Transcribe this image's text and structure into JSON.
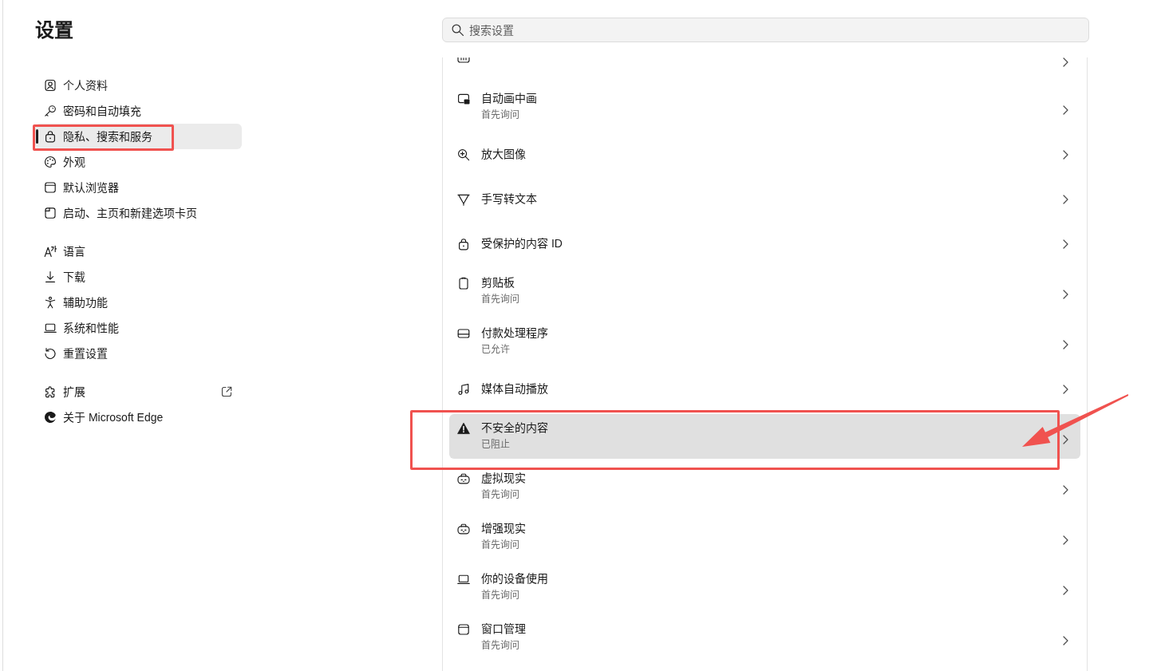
{
  "sidebar": {
    "title": "设置",
    "groups": [
      {
        "items": [
          {
            "label": "个人资料",
            "selected": false,
            "external_link": false,
            "annotated": false
          },
          {
            "label": "密码和自动填充",
            "selected": false,
            "external_link": false,
            "annotated": false
          },
          {
            "label": "隐私、搜索和服务",
            "selected": true,
            "external_link": false,
            "annotated": true
          },
          {
            "label": "外观",
            "selected": false,
            "external_link": false,
            "annotated": false
          },
          {
            "label": "默认浏览器",
            "selected": false,
            "external_link": false,
            "annotated": false
          },
          {
            "label": "启动、主页和新建选项卡页",
            "selected": false,
            "external_link": false,
            "annotated": false
          }
        ]
      },
      {
        "items": [
          {
            "label": "语言",
            "selected": false,
            "external_link": false,
            "annotated": false
          },
          {
            "label": "下载",
            "selected": false,
            "external_link": false,
            "annotated": false
          },
          {
            "label": "辅助功能",
            "selected": false,
            "external_link": false,
            "annotated": false
          },
          {
            "label": "系统和性能",
            "selected": false,
            "external_link": false,
            "annotated": false
          },
          {
            "label": "重置设置",
            "selected": false,
            "external_link": false,
            "annotated": false
          }
        ]
      },
      {
        "items": [
          {
            "label": "扩展",
            "selected": false,
            "external_link": true,
            "annotated": false
          },
          {
            "label": "关于 Microsoft Edge",
            "selected": false,
            "external_link": false,
            "annotated": false
          }
        ]
      }
    ]
  },
  "search": {
    "placeholder": "搜索设置"
  },
  "permissions": {
    "rows": [
      {
        "kind": "partial",
        "highlighted": false,
        "annotated": false,
        "arrow": false
      },
      {
        "kind": "item",
        "title": "自动画中画",
        "subtitle": "首先询问",
        "highlighted": false,
        "annotated": false,
        "arrow": false
      },
      {
        "kind": "item",
        "title": "放大图像",
        "highlighted": false,
        "annotated": false,
        "arrow": false
      },
      {
        "kind": "item",
        "title": "手写转文本",
        "highlighted": false,
        "annotated": false,
        "arrow": false
      },
      {
        "kind": "item",
        "title": "受保护的内容 ID",
        "highlighted": false,
        "annotated": false,
        "arrow": false
      },
      {
        "kind": "item",
        "title": "剪贴板",
        "subtitle": "首先询问",
        "highlighted": false,
        "annotated": false,
        "arrow": false
      },
      {
        "kind": "item",
        "title": "付款处理程序",
        "subtitle": "已允许",
        "highlighted": false,
        "annotated": false,
        "arrow": false
      },
      {
        "kind": "item",
        "title": "媒体自动播放",
        "highlighted": false,
        "annotated": false,
        "arrow": false
      },
      {
        "kind": "item",
        "title": "不安全的内容",
        "subtitle": "已阻止",
        "highlighted": true,
        "annotated": true,
        "arrow": true
      },
      {
        "kind": "item",
        "title": "虚拟现实",
        "subtitle": "首先询问",
        "highlighted": false,
        "annotated": false,
        "arrow": false
      },
      {
        "kind": "item",
        "title": "增强现实",
        "subtitle": "首先询问",
        "highlighted": false,
        "annotated": false,
        "arrow": false
      },
      {
        "kind": "item",
        "title": "你的设备使用",
        "subtitle": "首先询问",
        "highlighted": false,
        "annotated": false,
        "arrow": false
      },
      {
        "kind": "item",
        "title": "窗口管理",
        "subtitle": "首先询问",
        "highlighted": false,
        "annotated": false,
        "arrow": false
      }
    ]
  }
}
